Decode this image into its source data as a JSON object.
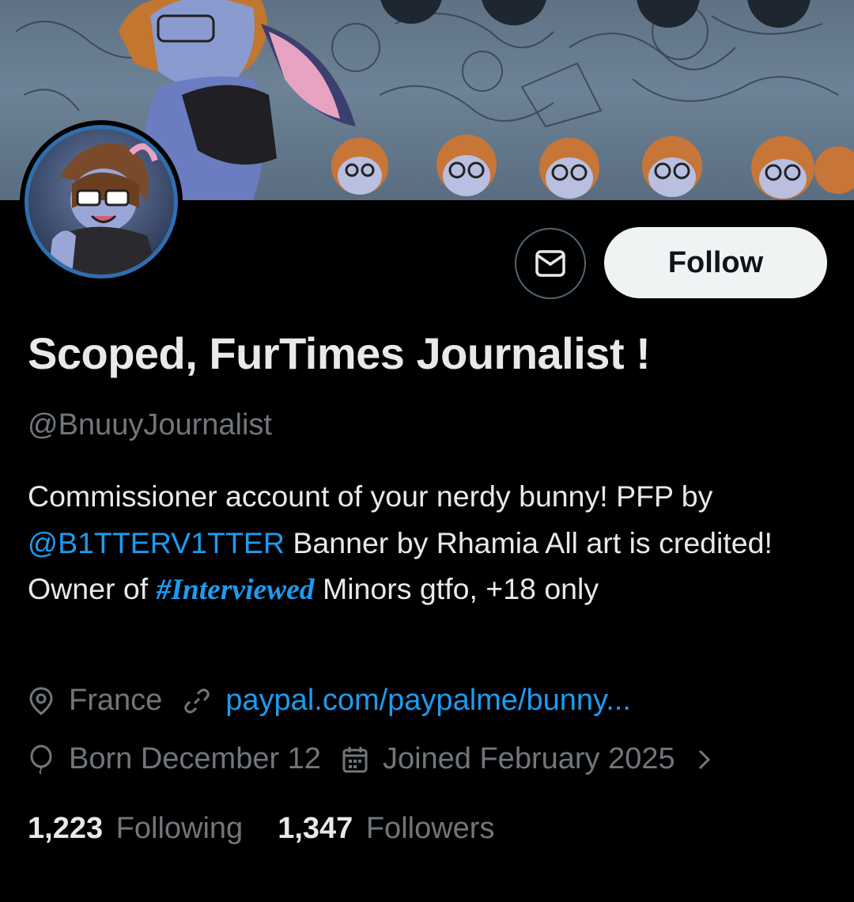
{
  "profile": {
    "display_name": "Scoped, FurTimes Journalist !",
    "handle": "@BnuuyJournalist",
    "bio": {
      "part1": "Commissioner account of your nerdy bunny!  PFP by ",
      "mention": "@B1TTERV1TTER",
      "part2": " Banner by Rhamia  All art is credited!  Owner of ",
      "hashtag": "#Interviewed",
      "part3": "  Minors gtfo, +18 only"
    },
    "location": "France",
    "website": "paypal.com/paypalme/bunny...",
    "birthday": "Born December 12",
    "joined": "Joined February 2025"
  },
  "actions": {
    "follow_label": "Follow"
  },
  "stats": {
    "following_count": "1,223",
    "following_label": "Following",
    "followers_count": "1,347",
    "followers_label": "Followers"
  },
  "icons": {
    "message": "envelope-icon",
    "location": "location-pin-icon",
    "website": "link-icon",
    "birthday": "balloon-icon",
    "joined": "calendar-icon",
    "more": "chevron-right-icon"
  },
  "colors": {
    "background": "#000000",
    "text_primary": "#e7e9ea",
    "text_secondary": "#71767b",
    "link": "#1d9bf0",
    "follow_button_bg": "#eff3f4",
    "avatar_ring": "#2f6fb0"
  }
}
